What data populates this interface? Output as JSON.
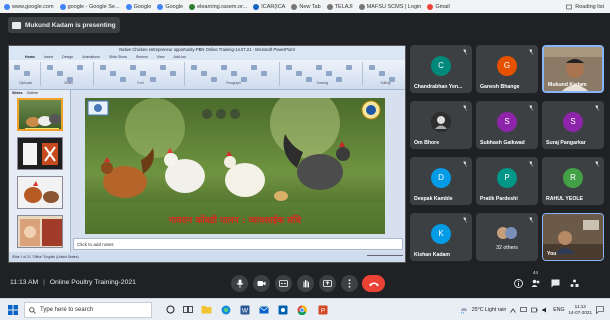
{
  "browser": {
    "bookmarks": [
      {
        "label": "www.google.com",
        "icon": "google-icon",
        "color": "#4285f4"
      },
      {
        "label": "google - Google Se...",
        "icon": "google-icon",
        "color": "#4285f4"
      },
      {
        "label": "Google",
        "icon": "google-icon",
        "color": "#4285f4"
      },
      {
        "label": "Google",
        "icon": "google-icon",
        "color": "#4285f4"
      },
      {
        "label": "elearning.rasem.or...",
        "icon": "elearning-icon",
        "color": "#2e7d32"
      },
      {
        "label": "ICAR(ICA",
        "icon": "icar-icon",
        "color": "#1565c0"
      },
      {
        "label": "New Tab",
        "icon": "page-icon",
        "color": "#777777"
      },
      {
        "label": "TELAJI",
        "icon": "page-icon",
        "color": "#777777"
      },
      {
        "label": "MAFSU SCMS | Login",
        "icon": "page-icon",
        "color": "#777777"
      },
      {
        "label": "Gmail",
        "icon": "google-icon",
        "color": "#ea4335"
      }
    ],
    "reading_list": "Reading list"
  },
  "meet": {
    "presenting_label": "Mukund Kadam is presenting",
    "time": "11:13 AM",
    "separator": "|",
    "meeting_title": "Online Poultry Training-2021",
    "participants": [
      {
        "name": "Chandrabhan Yen...",
        "initial": "C",
        "color": "#00897b"
      },
      {
        "name": "Ganesh Bhange",
        "initial": "G",
        "color": "#e65100"
      },
      {
        "name": "Mukund Kadam",
        "initial": "",
        "color": "#5f6368",
        "video": true
      },
      {
        "name": "Om Bhore",
        "initial": "",
        "color": "#5f6368",
        "photo": true
      },
      {
        "name": "Subhash Gaikwad",
        "initial": "S",
        "color": "#8e24aa"
      },
      {
        "name": "Suraj Pangarkar",
        "initial": "S",
        "color": "#8e24aa"
      },
      {
        "name": "Deepak Kamble",
        "initial": "D",
        "color": "#039be5"
      },
      {
        "name": "Pratik Pardeshi",
        "initial": "P",
        "color": "#009688"
      },
      {
        "name": "RAHUL YEOLE",
        "initial": "R",
        "color": "#43a047"
      },
      {
        "name": "Kishan Kadam",
        "initial": "K",
        "color": "#039be5"
      },
      {
        "name": "32 others",
        "initial": "",
        "color": "#5f6368"
      },
      {
        "name": "You",
        "initial": "",
        "color": "#5f6368",
        "video": true
      }
    ],
    "controls": [
      "mic-icon",
      "camera-icon",
      "captions-icon",
      "raise-hand-icon",
      "present-icon",
      "more-options-icon",
      "end-call-icon"
    ],
    "right_controls": [
      "info-icon",
      "people-icon",
      "chat-icon",
      "activities-icon"
    ],
    "people_badge": "44"
  },
  "ppt": {
    "window_title": "Native Chicken entrepreneur opportunity-PBN Online Training-14.07.21 - Microsoft PowerPoint",
    "tabs": [
      "Home",
      "Insert",
      "Design",
      "Animations",
      "Slide Show",
      "Review",
      "View",
      "Add-Ins"
    ],
    "ribbon_groups": [
      "Clipboard",
      "Slides",
      "Font",
      "Paragraph",
      "Drawing",
      "Editing"
    ],
    "pane_tabs": [
      "Slides",
      "Outline"
    ],
    "slide_caption": "गावरान कोंबडी पालन : व्यावसाईक संधि",
    "notes_placeholder": "Click to add notes",
    "status": "Slide 1 of 21    \"Office\"    English (United States)",
    "thumb_numbers": [
      "1",
      "2",
      "3",
      "4",
      "5"
    ]
  },
  "taskbar": {
    "search_placeholder": "Type here to search",
    "weather": "25°C  Light rain",
    "language": "ENG",
    "time": "11:13",
    "date": "14-07-2021"
  },
  "colors": {
    "meet_bg": "#202124",
    "tile_bg": "#3c4043",
    "end_call": "#ea4335"
  }
}
